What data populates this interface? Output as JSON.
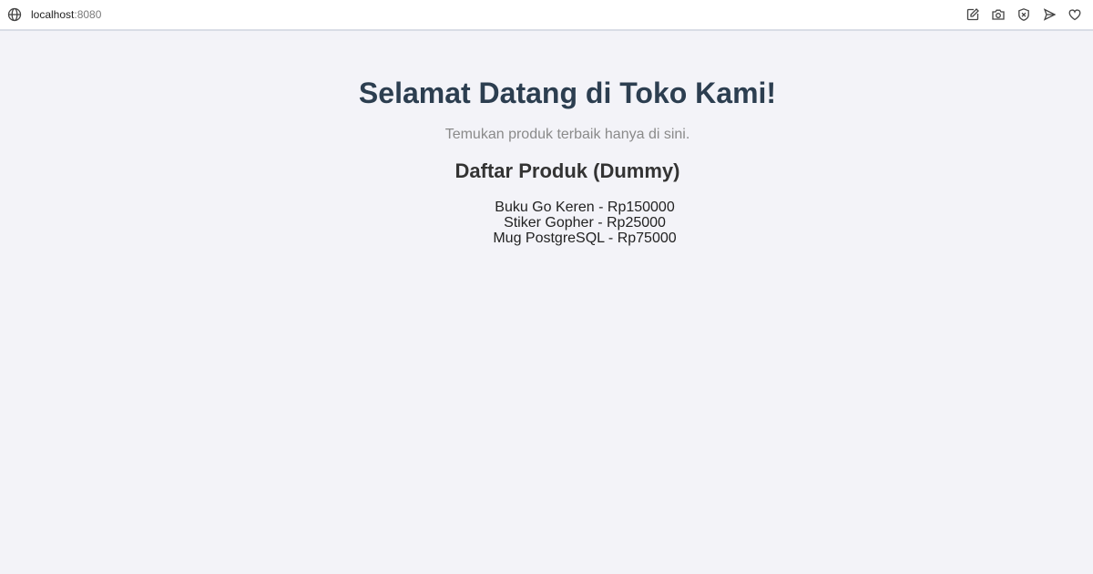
{
  "browser": {
    "url_host": "localhost",
    "url_port": ":8080",
    "icons": [
      "globe-icon",
      "edit-icon",
      "camera-icon",
      "shield-close-icon",
      "send-icon",
      "heart-icon"
    ]
  },
  "page": {
    "title": "Selamat Datang di Toko Kami!",
    "subtitle": "Temukan produk terbaik hanya di sini.",
    "section_title": "Daftar Produk (Dummy)",
    "products": [
      "Buku Go Keren - Rp150000",
      "Stiker Gopher - Rp25000",
      "Mug PostgreSQL - Rp75000"
    ]
  },
  "colors": {
    "background": "#f3f3f8",
    "title": "#2c3e50",
    "subtitle": "#8a8a8a"
  }
}
